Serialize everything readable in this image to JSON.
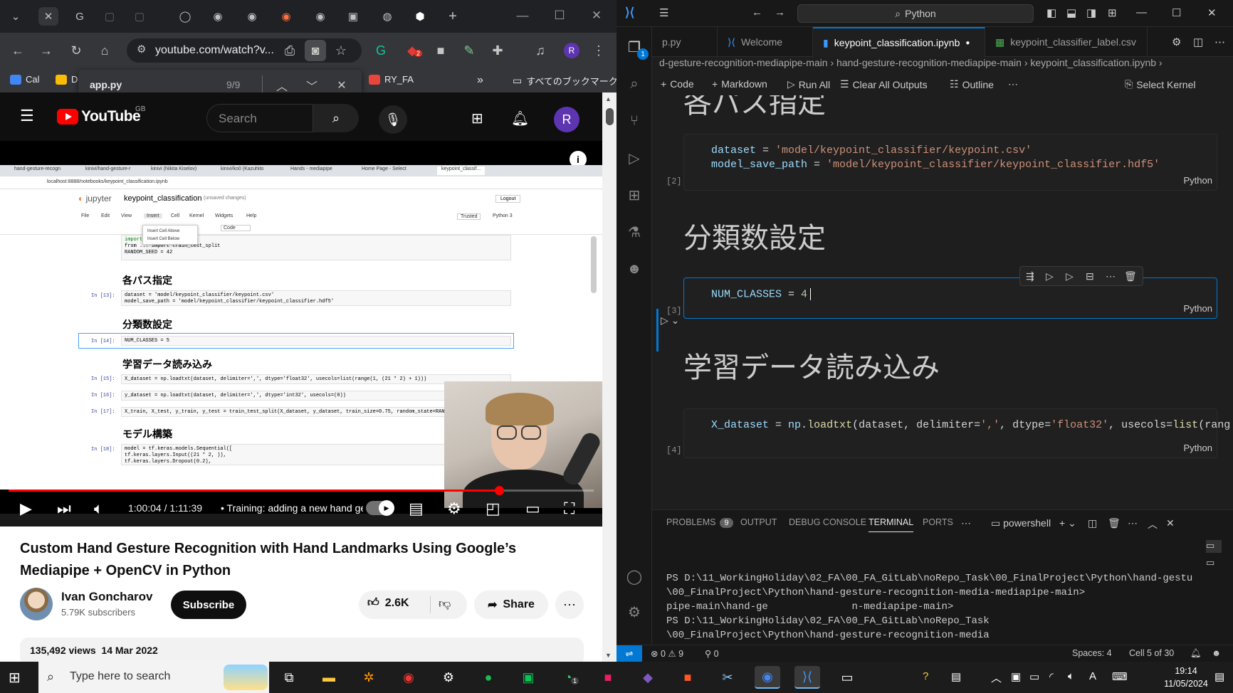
{
  "chrome": {
    "url": "youtube.com/watch?v...",
    "profile_initial": "R",
    "extension_badge": "2",
    "bookmarks": [
      {
        "label": "Cal"
      },
      {
        "label": "D"
      },
      {
        "label": "RY_FA"
      }
    ],
    "all_bookmarks": "すべてのブックマーク",
    "find": {
      "query": "app.py",
      "count": "9/9"
    }
  },
  "youtube": {
    "logo_text": "YouTube",
    "region": "GB",
    "search_placeholder": "Search",
    "avatar_initial": "R",
    "player": {
      "time": "1:00:04 / 1:11:39",
      "chapter": "• Training: adding a new hand ge",
      "progress": 0.838,
      "info_icon": "i"
    },
    "video": {
      "title": "Custom Hand Gesture Recognition with Hand Landmarks Using Google’s Mediapipe + OpenCV in Python",
      "channel": "Ivan Goncharov",
      "subscribers": "5.79K subscribers",
      "subscribe_label": "Subscribe",
      "likes": "2.6K",
      "share_label": "Share",
      "views_date": "135,492 views  14 Mar 2022"
    }
  },
  "jupyter_video": {
    "logo": "jupyter",
    "notebook": "keypoint_classification",
    "saved": "(unsaved changes)",
    "url": "localhost:8888/notebooks/keypoint_classification.ipynb",
    "tabs": [
      "hand-gesture-recogn",
      "kinivi/hand-gesture-r",
      "kinivi (Nikita Kiselov)",
      "kinivi/ko0 (Kazuhito",
      "Hands - mediapipe",
      "Home Page - Select",
      "keypoint_classif..."
    ],
    "menu": [
      "File",
      "Edit",
      "View",
      "Insert",
      "Cell",
      "Kernel",
      "Widgets",
      "Help"
    ],
    "dropdown": [
      "Insert Cell Above",
      "Insert Cell Below"
    ],
    "kernel": "Python 3",
    "trusted": "Trusted",
    "logout": "Logout",
    "cell_type": "Code",
    "import_line": "from ... import train_test_split",
    "random_seed": "RANDOM_SEED = 42",
    "h_paths": "各パス指定",
    "h_classes": "分類数設定",
    "h_data": "学習データ読み込み",
    "h_model": "モデル構築",
    "cells": [
      {
        "prompt": "In [13]:",
        "code": "dataset = 'model/keypoint_classifier/keypoint.csv'"
      },
      {
        "prompt": "",
        "code": "model_save_path = 'model/keypoint_classifier/keypoint_classifier.hdf5'"
      },
      {
        "prompt": "In [14]:",
        "code": "NUM_CLASSES = 5"
      },
      {
        "prompt": "In [15]:",
        "code": "X_dataset = np.loadtxt(dataset, delimiter=',', dtype='float32', usecols=list(range(1, (21 * 2) + 1)))"
      },
      {
        "prompt": "In [16]:",
        "code": "y_dataset = np.loadtxt(dataset, delimiter=',', dtype='int32', usecols=(0))"
      },
      {
        "prompt": "In [17]:",
        "code": "X_train, X_test, y_train, y_test = train_test_split(X_dataset, y_dataset, train_size=0.75, random_state=RANDOM_SEED)"
      },
      {
        "prompt": "In [18]:",
        "code": "model = tf.keras.models.Sequential(["
      },
      {
        "prompt": "",
        "code": "    tf.keras.layers.Input((21 * 2, )),"
      },
      {
        "prompt": "",
        "code": "    tf.keras.layers.Dropout(0.2),"
      }
    ]
  },
  "vscode": {
    "search": "Python",
    "explorer_badge": "1",
    "tabs": [
      {
        "label": "p.py",
        "icon": "python-icon"
      },
      {
        "label": "Welcome",
        "icon": "vscode-icon"
      },
      {
        "label": "keypoint_classification.ipynb",
        "icon": "notebook-icon"
      },
      {
        "label": "keypoint_classifier_label.csv",
        "icon": "csv-icon"
      }
    ],
    "breadcrumb": "d-gesture-recognition-mediapipe-main  ›  hand-gesture-recognition-mediapipe-main  ›  keypoint_classification.ipynb  ›",
    "toolbar": {
      "code": "Code",
      "markdown": "Markdown",
      "run_all": "Run All",
      "clear": "Clear All Outputs",
      "outline": "Outline",
      "kernel": "Select Kernel"
    },
    "headings": {
      "paths": "各パス指定",
      "classes": "分類数設定",
      "data": "学習データ読み込み"
    },
    "cell2": {
      "count": "[2]",
      "line1_var": "dataset",
      "line1_str": "'model/keypoint_classifier/keypoint.csv'",
      "line2_var": "model_save_path",
      "line2_str": "'model/keypoint_classifier/keypoint_classifier.hdf5'",
      "lang": "Python"
    },
    "cell3": {
      "count": "[3]",
      "var": "NUM_CLASSES",
      "value": "4",
      "lang": "Python"
    },
    "cell4": {
      "count": "[4]",
      "var": "X_dataset",
      "rest_mod": "np",
      "rest_fn": "loadtxt",
      "rest_args_a": "(dataset, delimiter=",
      "rest_str1": "','",
      "rest_args_b": ", dtype=",
      "rest_str2": "'float32'",
      "rest_args_c": ", usecols=",
      "rest_fn2": "list",
      "rest_args_d": "(rang",
      "lang": "Python"
    },
    "panel": {
      "problems": "PROBLEMS",
      "problems_count": "9",
      "output": "OUTPUT",
      "debug": "DEBUG CONSOLE",
      "terminal": "TERMINAL",
      "ports": "PORTS",
      "shell": "powershell",
      "terminal_lines": [
        "PS D:\\11_WorkingHoliday\\02_FA\\00_FA_GitLab\\noRepo_Task\\00_FinalProject\\Python\\hand-gestu",
        "\\00_FinalProject\\Python\\hand-gesture-recognition-media-mediapipe-main>",
        "pipe-main\\hand-ge              n-mediapipe-main>",
        "PS D:\\11_WorkingHoliday\\02_FA\\00_FA_GitLab\\noRepo_Task",
        "\\00_FinalProject\\Python\\hand-gesture-recognition-media"
      ]
    },
    "status": {
      "errors": "0",
      "warnings": "9",
      "ports": "0",
      "spaces": "Spaces: 4",
      "cell": "Cell 5 of 30"
    }
  },
  "taskbar": {
    "search_placeholder": "Type here to search",
    "time": "19:14",
    "date": "11/05/2024",
    "whatsapp_badge": "1",
    "ime": "A"
  }
}
